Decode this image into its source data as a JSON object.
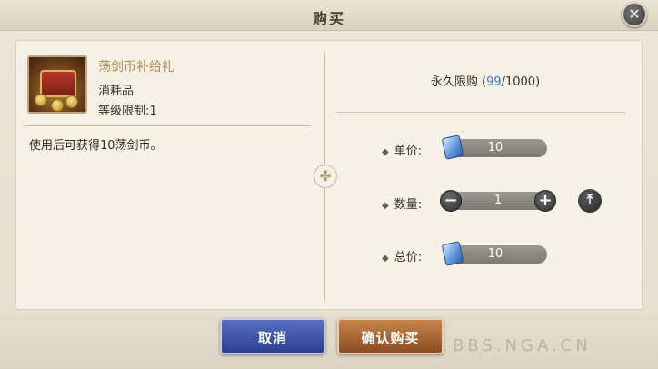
{
  "dialog": {
    "title": "购买",
    "close_icon": "close-icon"
  },
  "item": {
    "icon": "treasure-chest-icon",
    "name": "荡剑币补给礼",
    "type": "消耗品",
    "level_limit": "等级限制:1",
    "description": "使用后可获得10荡剑币。"
  },
  "purchase": {
    "limit_label": "永久限购 (",
    "limit_used": "99",
    "limit_sep": "/1000)",
    "unit_price_label": "单价:",
    "unit_price": "10",
    "quantity_label": "数量:",
    "quantity": "1",
    "total_label": "总价:",
    "total": "10",
    "currency_icon": "ticket-currency-icon",
    "max_icon": "max-quantity-icon"
  },
  "buttons": {
    "cancel": "取消",
    "confirm": "确认购买"
  },
  "watermark": "BBS.NGA.CN",
  "colors": {
    "item_name": "#b08a4e",
    "limit_number": "#3a78c8",
    "cancel_button": "#3a4fa5",
    "confirm_button": "#a8653a"
  }
}
